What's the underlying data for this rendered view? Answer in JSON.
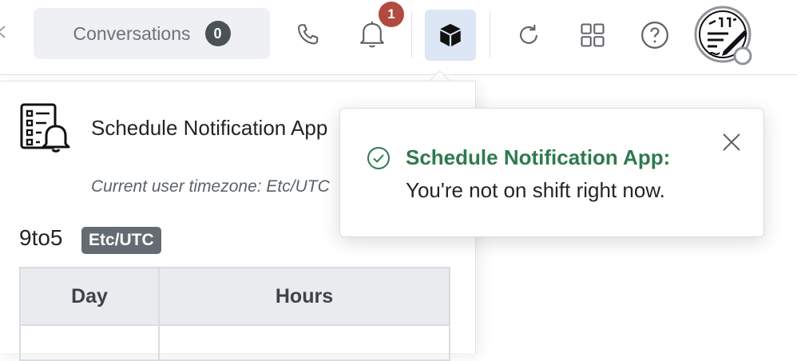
{
  "header": {
    "conversations_label": "Conversations",
    "conversations_count": "0",
    "notification_count": "1",
    "icons": {
      "phone": "phone-icon",
      "bell": "bell-icon",
      "apps": "cube-icon",
      "refresh": "refresh-icon",
      "grid": "grid-icon",
      "help": "help-icon",
      "avatar": "user-avatar"
    }
  },
  "panel": {
    "app_title": "Schedule Notification App",
    "timezone_line": "Current user timezone: Etc/UTC",
    "schedule_name": "9to5",
    "schedule_timezone": "Etc/UTC",
    "table": {
      "headers": [
        "Day",
        "Hours"
      ]
    }
  },
  "toast": {
    "title": "Schedule Notification App:",
    "message": "You're not on shift right now."
  },
  "colors": {
    "badge_red": "#b24a3f",
    "success_green": "#2e7a4e",
    "active_blue_bg": "#dce6f5"
  }
}
